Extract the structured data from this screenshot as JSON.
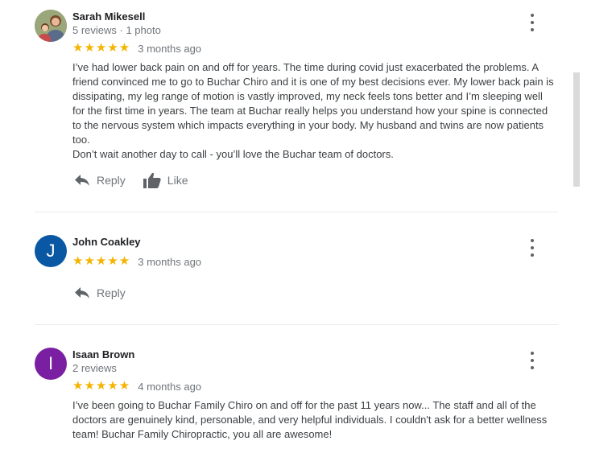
{
  "reviews": [
    {
      "name": "Sarah Mikesell",
      "meta": "5 reviews · 1 photo",
      "stars": "★★★★★",
      "date": "3 months ago",
      "text_p1": "I’ve had lower back pain on and off for years. The time during covid just exacerbated the problems. A friend convinced me to go to Buchar Chiro and it is one of my best decisions ever. My lower back pain is dissipating, my leg range of motion is vastly improved, my neck feels tons better and I’m sleeping well for the first time in years. The team at Buchar really helps you understand how your spine is connected to the nervous system which impacts everything in your body. My husband and twins are now patients too.",
      "text_p2": "Don’t wait another day to call - you’ll love the Buchar team of doctors.",
      "reply_label": "Reply",
      "like_label": "Like"
    },
    {
      "name": "John Coakley",
      "avatar_letter": "J",
      "avatar_color": "#0a58a3",
      "stars": "★★★★★",
      "date": "3 months ago",
      "reply_label": "Reply"
    },
    {
      "name": "Isaan Brown",
      "avatar_letter": "I",
      "avatar_color": "#7b1fa2",
      "meta": "2 reviews",
      "stars": "★★★★★",
      "date": "4 months ago",
      "text_p1": "I’ve been going to Buchar Family Chiro on and off for the past 11 years now... The staff and all of the doctors are genuinely kind, personable, and very helpful individuals. I couldn't ask for a better wellness team! Buchar Family Chiropractic, you all are awesome!"
    }
  ],
  "colors": {
    "star": "#f4b400",
    "secondary_text": "#70757a",
    "divider": "#ebebeb"
  },
  "icons": {
    "more": "more-vert-icon",
    "reply": "reply-icon",
    "like": "thumb-up-icon"
  }
}
